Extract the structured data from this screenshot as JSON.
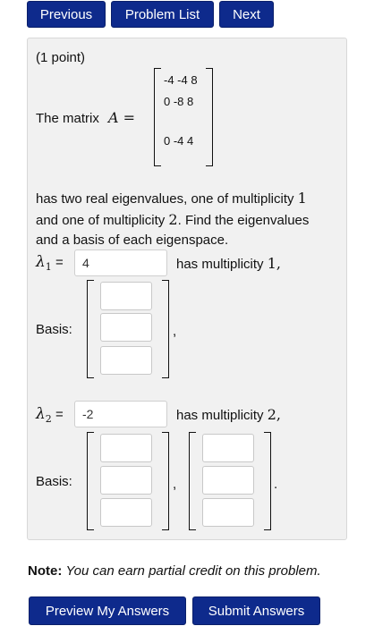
{
  "nav": {
    "previous_label": "Previous",
    "problem_list_label": "Problem List",
    "next_label": "Next"
  },
  "problem": {
    "points": "(1 point)",
    "matrix_label": "The matrix",
    "matrix_var": "A =",
    "matrix_rows": [
      "-4 -4 8",
      "0 -8 8",
      "0 -4 4"
    ],
    "intro_line1_a": "has two real eigenvalues, one of multiplicity",
    "intro_line1_b": "1",
    "intro_line2_a": "and one of multiplicity",
    "intro_line2_b": "2",
    "intro_line2_c": ". Find the eigenvalues",
    "intro_line3": "and a basis of each eigenspace."
  },
  "eigen1": {
    "lambda_label": "λ",
    "subscript": "1",
    "equals": "=",
    "value": "4",
    "mult_text": "has multiplicity",
    "mult_value": "1,",
    "basis_label": "Basis:",
    "trailing": ","
  },
  "eigen2": {
    "lambda_label": "λ",
    "subscript": "2",
    "equals": "=",
    "value": "-2",
    "mult_text": "has multiplicity",
    "mult_value": "2,",
    "basis_label": "Basis:",
    "separator": ",",
    "trailing": "."
  },
  "note": {
    "label": "Note:",
    "text": "You can earn partial credit on this problem."
  },
  "actions": {
    "preview_label": "Preview My Answers",
    "submit_label": "Submit Answers"
  }
}
